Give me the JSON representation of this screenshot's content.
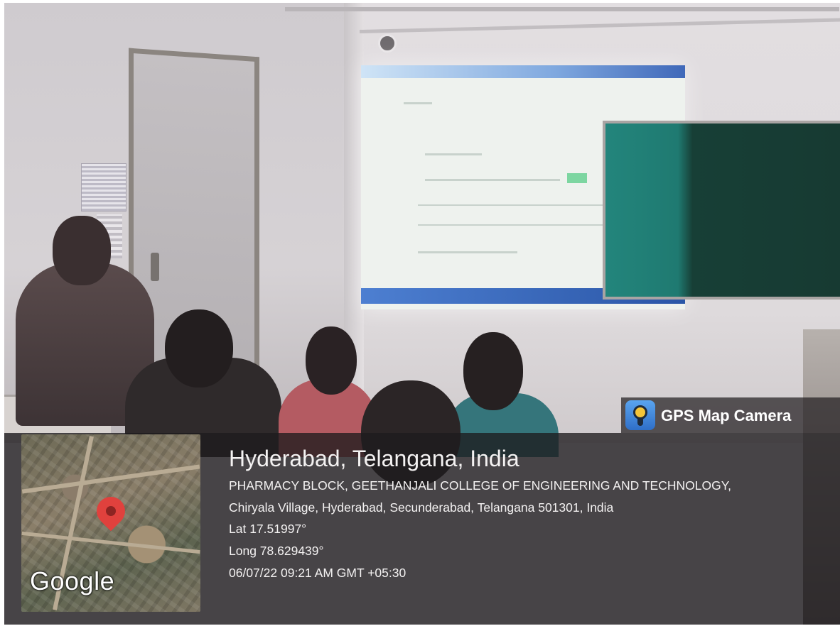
{
  "overlay": {
    "app_name": "GPS Map Camera",
    "app_icon": "gps-map-camera-icon",
    "map_provider_logo": "Google",
    "location_title": "Hyderabad, Telangana, India",
    "address_line_1": "PHARMACY BLOCK, GEETHANJALI COLLEGE OF ENGINEERING AND TECHNOLOGY,",
    "address_line_2": "Chiryala Village, Hyderabad, Secunderabad, Telangana 501301, India",
    "latitude": "Lat 17.51997°",
    "longitude": "Long 78.629439°",
    "timestamp": "06/07/22 09:21 AM GMT +05:30",
    "pin_color": "#e0413d"
  },
  "scene": {
    "projector_titlebar_color": "#3f68b9",
    "chalkboard_color": "#1f7a71"
  }
}
